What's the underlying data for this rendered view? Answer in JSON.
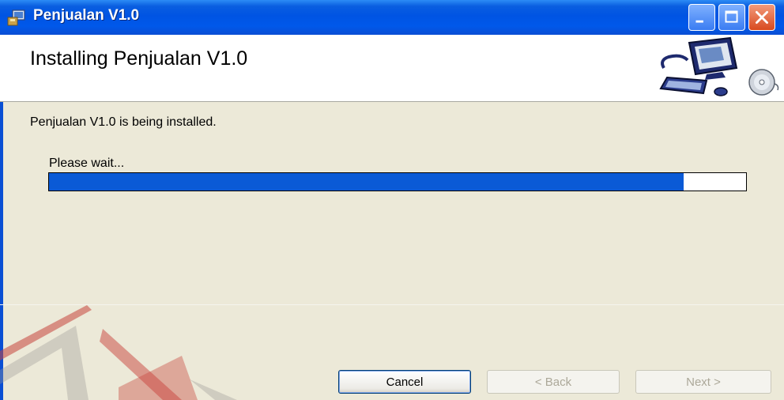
{
  "window": {
    "title": "Penjualan V1.0"
  },
  "header": {
    "title": "Installing Penjualan V1.0"
  },
  "body": {
    "status_text": "Penjualan V1.0 is being installed.",
    "wait_text": "Please wait...",
    "progress_percent": 91
  },
  "buttons": {
    "cancel": "Cancel",
    "back": "< Back",
    "next": "Next >"
  },
  "colors": {
    "progress_fill": "#0a5ad6",
    "titlebar": "#0054e3",
    "dialog_bg": "#ece9d8"
  },
  "icons": [
    "setup-icon",
    "minimize-icon",
    "maximize-icon",
    "close-icon",
    "computer-install-illustration"
  ]
}
